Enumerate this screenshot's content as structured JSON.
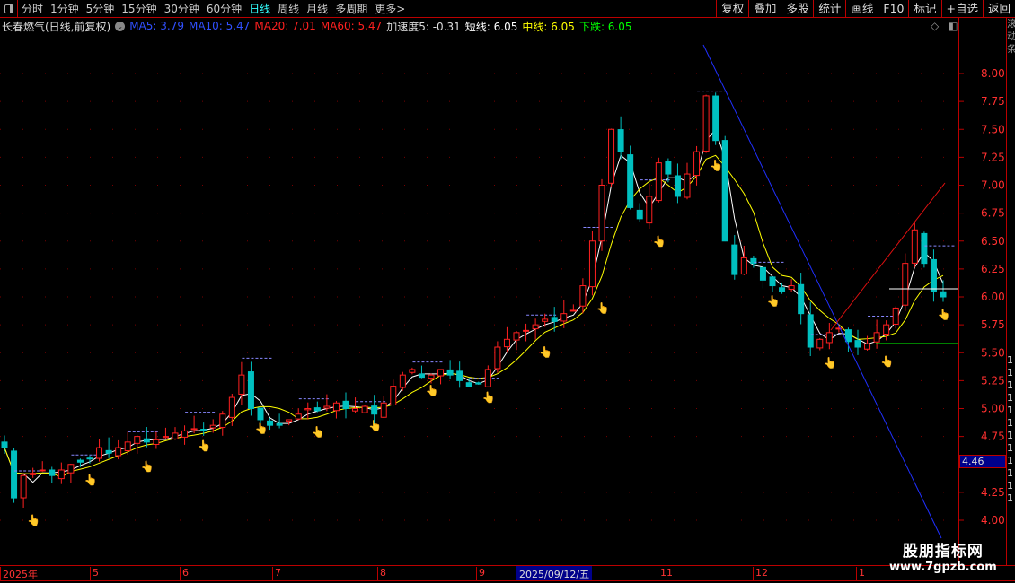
{
  "toolbar": {
    "periods": [
      "分时",
      "1分钟",
      "5分钟",
      "15分钟",
      "30分钟",
      "60分钟",
      "日线",
      "周线",
      "月线",
      "多周期",
      "更多>"
    ],
    "active_period": "日线",
    "right_buttons": [
      "复权",
      "叠加",
      "多股",
      "统计",
      "画线",
      "F10",
      "标记",
      "+自选",
      "返回"
    ]
  },
  "info": {
    "title": "长春燃气(日线,前复权)",
    "ma5": "MA5: 3.79",
    "ma10": "MA10: 5.47",
    "ma20": "MA20: 7.01",
    "ma60": "MA60: 5.47",
    "accel": "加速度5: -0.31",
    "short": "短线: 6.05",
    "mid": "中线: 6.05",
    "down": "下跌: 6.05"
  },
  "colors": {
    "up": "#ff2020",
    "down": "#00c0c0",
    "ma5": "#3050ff",
    "ma20": "#ff2020",
    "mid": "#ffff00",
    "downline": "#00ff00",
    "axis": "#b00000",
    "price_label": "#ff3030"
  },
  "price_tag": "4.46",
  "right_panel_chars": [
    "1",
    "1",
    "1",
    "1",
    "1",
    "1",
    "1",
    "1",
    "1",
    "1",
    "1",
    "1"
  ],
  "date_axis": {
    "labels": [
      "2025年",
      "5",
      "6",
      "7",
      "8",
      "9",
      "11",
      "12",
      "1"
    ],
    "selected": "2025/09/12/五"
  },
  "watermark": {
    "line1": "股朋指标网",
    "line2": "www.7gpzb.com"
  },
  "chart_data": {
    "type": "candlestick",
    "yticks": [
      "8.00",
      "7.75",
      "7.50",
      "7.25",
      "7.00",
      "6.75",
      "6.50",
      "6.25",
      "6.00",
      "5.75",
      "5.50",
      "5.25",
      "5.00",
      "4.75",
      "4.25",
      "4.00"
    ],
    "ylim": [
      3.95,
      8.3
    ],
    "closes": [
      4.65,
      4.2,
      4.4,
      4.42,
      4.45,
      4.4,
      4.45,
      4.5,
      4.52,
      4.55,
      4.65,
      4.6,
      4.65,
      4.7,
      4.75,
      4.7,
      4.72,
      4.75,
      4.78,
      4.8,
      4.82,
      4.8,
      4.85,
      4.95,
      5.1,
      5.3,
      5.0,
      4.9,
      4.85,
      4.85,
      4.9,
      4.95,
      5.0,
      4.98,
      5.02,
      5.05,
      5.0,
      5.0,
      5.02,
      4.95,
      5.05,
      5.2,
      5.3,
      5.35,
      5.28,
      5.3,
      5.35,
      5.3,
      5.25,
      5.2,
      5.22,
      5.35,
      5.55,
      5.62,
      5.68,
      5.7,
      5.75,
      5.8,
      5.78,
      5.85,
      5.88,
      6.1,
      6.5,
      7.0,
      7.5,
      7.3,
      6.8,
      6.7,
      6.9,
      7.2,
      7.1,
      6.9,
      7.1,
      7.3,
      7.8,
      7.4,
      6.5,
      6.2,
      6.35,
      6.3,
      6.15,
      6.1,
      6.05,
      6.1,
      5.85,
      5.55,
      5.62,
      5.68,
      5.72,
      5.6,
      5.55,
      5.58,
      5.68,
      5.75,
      5.9,
      6.3,
      6.6,
      6.3,
      6.05,
      6.0
    ]
  }
}
